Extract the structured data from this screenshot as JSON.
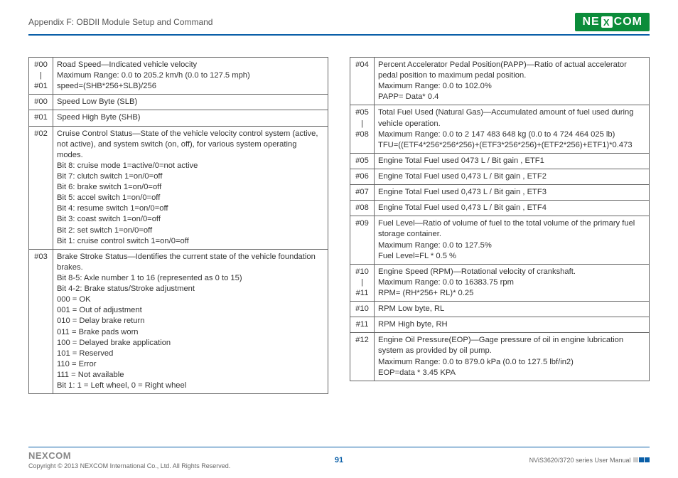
{
  "header": {
    "appendix": "Appendix F: OBDII Module Setup and Command",
    "logo_text_left": "NE",
    "logo_text_x": "X",
    "logo_text_right": "COM"
  },
  "left_table": [
    {
      "code": "#00\n|\n#01",
      "desc": "Road Speed—Indicated vehicle velocity\nMaximum Range: 0.0 to 205.2 km/h (0.0 to 127.5 mph)\nspeed=(SHB*256+SLB)/256"
    },
    {
      "code": "#00",
      "desc": "Speed Low Byte (SLB)"
    },
    {
      "code": "#01",
      "desc": "Speed High Byte (SHB)"
    },
    {
      "code": "#02",
      "desc": "Cruise Control Status—State of the vehicle velocity control system (active, not active), and system switch (on, off), for various system operating modes.\nBit 8: cruise mode 1=active/0=not active\nBit 7: clutch switch 1=on/0=off\nBit 6: brake switch 1=on/0=off\nBit 5: accel switch 1=on/0=off\nBit 4: resume switch 1=on/0=off\nBit 3: coast switch 1=on/0=off\nBit 2: set switch 1=on/0=off\nBit 1: cruise control switch 1=on/0=off"
    },
    {
      "code": "#03",
      "desc": "Brake Stroke Status—Identifies the current state of the vehicle foundation brakes.\nBit 8-5: Axle number 1 to 16 (represented as 0 to 15)\nBit 4-2: Brake status/Stroke adjustment\n000 = OK\n001 = Out of adjustment\n010 = Delay brake return\n011 = Brake pads worn\n100 = Delayed brake application\n101 = Reserved\n110 = Error\n111 = Not available\nBit 1: 1 = Left wheel, 0 = Right wheel"
    }
  ],
  "right_table": [
    {
      "code": "#04",
      "desc": "Percent Accelerator Pedal Position(PAPP)—Ratio of actual accelerator pedal position to maximum pedal position.\nMaximum Range: 0.0 to 102.0%\nPAPP= Data* 0.4"
    },
    {
      "code": "#05\n|\n#08",
      "desc": "Total Fuel Used (Natural Gas)—Accumulated amount of fuel used during vehicle operation.\nMaximum Range: 0.0 to 2 147 483 648 kg (0.0 to 4 724 464 025 lb)\nTFU=((ETF4*256*256*256)+(ETF3*256*256)+(ETF2*256)+ETF1)*0.473"
    },
    {
      "code": "#05",
      "desc": "Engine Total Fuel used 0473 L / Bit gain , ETF1"
    },
    {
      "code": "#06",
      "desc": "Engine Total Fuel used 0,473 L / Bit gain , ETF2"
    },
    {
      "code": "#07",
      "desc": "Engine Total Fuel used 0,473 L / Bit gain , ETF3"
    },
    {
      "code": "#08",
      "desc": "Engine Total Fuel used 0,473 L / Bit gain , ETF4"
    },
    {
      "code": "#09",
      "desc": "Fuel Level—Ratio of volume of fuel to the total volume of the primary fuel storage container.\nMaximum Range: 0.0 to 127.5%\nFuel Level=FL * 0.5 %"
    },
    {
      "code": "#10\n|\n#11",
      "desc": "Engine Speed (RPM)—Rotational velocity of crankshaft.\nMaximum Range: 0.0 to 16383.75 rpm\nRPM= (RH*256+ RL)* 0.25"
    },
    {
      "code": "#10",
      "desc": "RPM Low byte, RL"
    },
    {
      "code": "#11",
      "desc": "RPM High byte, RH"
    },
    {
      "code": "#12",
      "desc": "Engine Oil Pressure(EOP)—Gage pressure of oil in engine lubrication system as provided by oil pump.\nMaximum Range: 0.0 to 879.0 kPa (0.0 to 127.5 lbf/in2)\nEOP=data * 3.45 KPA"
    }
  ],
  "footer": {
    "logo": "NEXCOM",
    "copyright": "Copyright © 2013 NEXCOM International Co., Ltd. All Rights Reserved.",
    "page": "91",
    "manual": "NViS3620/3720 series User Manual"
  }
}
